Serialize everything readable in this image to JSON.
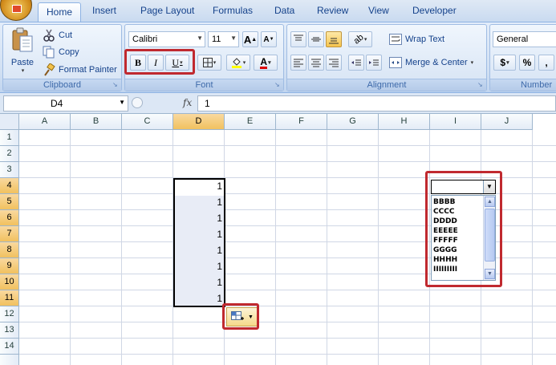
{
  "ribbon_tabs": [
    "Home",
    "Insert",
    "Page Layout",
    "Formulas",
    "Data",
    "Review",
    "View",
    "Developer"
  ],
  "active_tab": "Home",
  "clipboard": {
    "paste": "Paste",
    "cut": "Cut",
    "copy": "Copy",
    "format_painter": "Format Painter",
    "group_label": "Clipboard"
  },
  "font": {
    "family": "Calibri",
    "size": "11",
    "bold": "B",
    "italic": "I",
    "underline": "U",
    "font_color_glyph": "A",
    "grow": "A",
    "shrink": "A",
    "group_label": "Font"
  },
  "alignment": {
    "wrap_text": "Wrap Text",
    "merge_center": "Merge & Center",
    "group_label": "Alignment"
  },
  "number": {
    "format": "General",
    "currency": "$",
    "percent": "%",
    "comma": ",",
    "group_label": "Number"
  },
  "formula_bar": {
    "name_box": "D4",
    "fx": "fx",
    "content": "1"
  },
  "columns": [
    "A",
    "B",
    "C",
    "D",
    "E",
    "F",
    "G",
    "H",
    "I",
    "J"
  ],
  "selected_column": "D",
  "rows": [
    "1",
    "2",
    "3",
    "4",
    "5",
    "6",
    "7",
    "8",
    "9",
    "10",
    "11",
    "12",
    "13",
    "14"
  ],
  "selected_rows": [
    "4",
    "5",
    "6",
    "7",
    "8",
    "9",
    "10",
    "11"
  ],
  "cells_D": [
    "1",
    "1",
    "1",
    "1",
    "1",
    "1",
    "1",
    "1"
  ],
  "combo_box": {
    "value": "",
    "list_items": [
      "BBBB",
      "CCCC",
      "DDDD",
      "EEEEE",
      "FFFFF",
      "GGGG",
      "HHHH",
      "IIIIIIIII"
    ]
  },
  "highlight_color": "#c0292f",
  "selection_color": "#f1c15f"
}
